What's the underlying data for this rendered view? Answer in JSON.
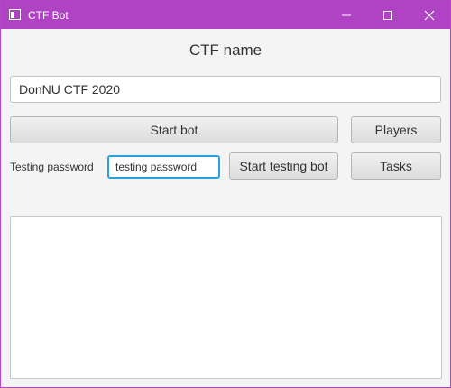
{
  "window": {
    "title": "CTF Bot",
    "icons": {
      "app": "app-window-icon",
      "minimize": "minimize-icon",
      "maximize": "maximize-icon",
      "close": "close-icon"
    },
    "accent_color": "#b043c4"
  },
  "main": {
    "heading": "CTF name",
    "ctf_name_value": "DonNU CTF 2020",
    "start_bot_label": "Start bot",
    "players_label": "Players",
    "testing_password_label": "Testing password",
    "testing_password_value": "testing password",
    "start_testing_bot_label": "Start testing bot",
    "tasks_label": "Tasks",
    "log_text": ""
  }
}
